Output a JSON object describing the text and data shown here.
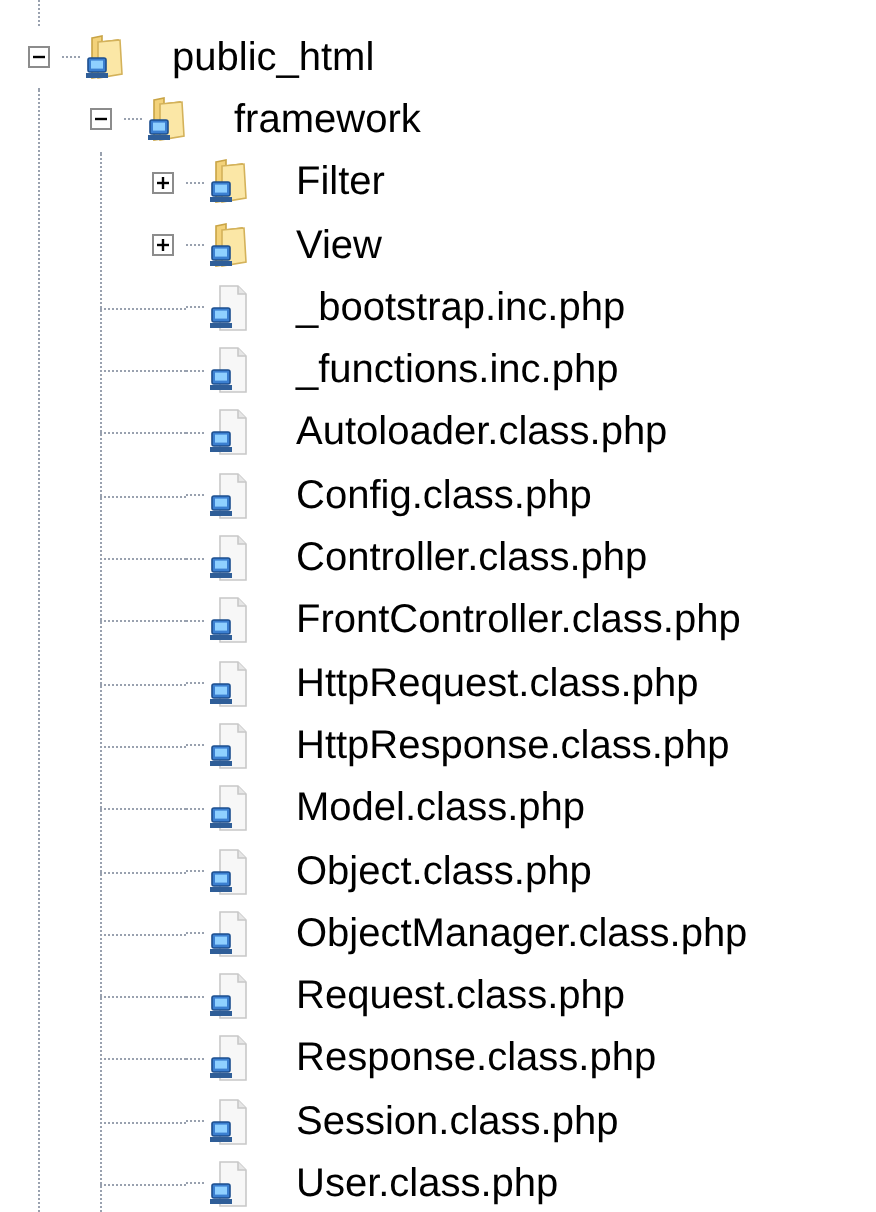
{
  "tree": [
    {
      "label": "public_html",
      "kind": "folder",
      "expanded": true,
      "children": [
        {
          "label": "framework",
          "kind": "folder",
          "expanded": true,
          "children": [
            {
              "label": "Filter",
              "kind": "folder",
              "expanded": false
            },
            {
              "label": "View",
              "kind": "folder",
              "expanded": false
            },
            {
              "label": "_bootstrap.inc.php",
              "kind": "file"
            },
            {
              "label": "_functions.inc.php",
              "kind": "file"
            },
            {
              "label": "Autoloader.class.php",
              "kind": "file"
            },
            {
              "label": "Config.class.php",
              "kind": "file"
            },
            {
              "label": "Controller.class.php",
              "kind": "file"
            },
            {
              "label": "FrontController.class.php",
              "kind": "file"
            },
            {
              "label": "HttpRequest.class.php",
              "kind": "file"
            },
            {
              "label": "HttpResponse.class.php",
              "kind": "file"
            },
            {
              "label": "Model.class.php",
              "kind": "file"
            },
            {
              "label": "Object.class.php",
              "kind": "file"
            },
            {
              "label": "ObjectManager.class.php",
              "kind": "file"
            },
            {
              "label": "Request.class.php",
              "kind": "file"
            },
            {
              "label": "Response.class.php",
              "kind": "file"
            },
            {
              "label": "Session.class.php",
              "kind": "file"
            },
            {
              "label": "User.class.php",
              "kind": "file"
            }
          ]
        }
      ]
    }
  ]
}
